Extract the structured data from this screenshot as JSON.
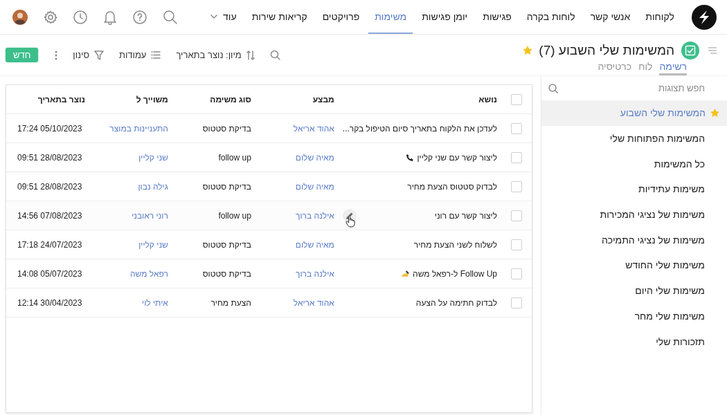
{
  "nav": {
    "items": [
      {
        "label": "לקוחות",
        "selected": false
      },
      {
        "label": "אנשי קשר",
        "selected": false
      },
      {
        "label": "לוחות בקרה",
        "selected": false
      },
      {
        "label": "פגישות",
        "selected": false
      },
      {
        "label": "יומן פגישות",
        "selected": false
      },
      {
        "label": "משימות",
        "selected": true
      },
      {
        "label": "פרויקטים",
        "selected": false
      },
      {
        "label": "קריאות שירות",
        "selected": false
      }
    ],
    "more": "עוד"
  },
  "view": {
    "title": "המשימות שלי השבוע (7)",
    "starred": true,
    "tabs": [
      {
        "label": "רשימה",
        "selected": true
      },
      {
        "label": "לוח",
        "selected": false
      },
      {
        "label": "כרטיסיה",
        "selected": false
      }
    ]
  },
  "toolbar": {
    "sort": "מיון: נוצר בתאריך",
    "columns": "עמודות",
    "filter": "סינון",
    "new_button": "חדש"
  },
  "sidebar": {
    "search": {
      "placeholder": "חפש תצוגות"
    },
    "items": [
      {
        "label": "המשימות שלי השבוע",
        "selected": true,
        "starred": true
      },
      {
        "label": "המשימות הפתוחות שלי",
        "selected": false,
        "starred": false
      },
      {
        "label": "כל המשימות",
        "selected": false,
        "starred": false
      },
      {
        "label": "משימות עתידיות",
        "selected": false,
        "starred": false
      },
      {
        "label": "משימות של נציגי המכירות",
        "selected": false,
        "starred": false
      },
      {
        "label": "משימות של נציגי התמיכה",
        "selected": false,
        "starred": false
      },
      {
        "label": "משימות שלי החודש",
        "selected": false,
        "starred": false
      },
      {
        "label": "משימות שלי היום",
        "selected": false,
        "starred": false
      },
      {
        "label": "משימות שלי מחר",
        "selected": false,
        "starred": false
      },
      {
        "label": "תזכורות שלי",
        "selected": false,
        "starred": false
      }
    ]
  },
  "table": {
    "all_checked": false,
    "columns": [
      "נושא",
      "מבצע",
      "סוג משימה",
      "משוייך ל",
      "נוצר בתאריך"
    ],
    "rows": [
      {
        "checked": false,
        "subject": "לעדכן את הלקוח בתאריך סיום הטיפול בקר...",
        "performer": "אהוד אריאל",
        "type": "בדיקת סטטוס",
        "assigned": "התעניינות במוצר",
        "created": "17:24 05/10/2023",
        "hovered": false
      },
      {
        "checked": false,
        "subject": "ליצור קשר עם שני קליין",
        "kind": "phone",
        "performer": "מאיה שלום",
        "type": "follow up",
        "assigned": "שני קליין",
        "created": "09:51 28/08/2023",
        "hovered": false
      },
      {
        "checked": false,
        "subject": "לבדוק סטטוס הצעת מחיר",
        "performer": "מאיה שלום",
        "type": "בדיקת סטטוס",
        "assigned": "גילה נבון",
        "created": "09:51 28/08/2023",
        "hovered": false
      },
      {
        "checked": false,
        "subject": "ליצור קשר עם רוני",
        "performer": "אילנה ברוך",
        "type": "follow up",
        "assigned": "רוני ראובני",
        "created": "14:56 07/08/2023",
        "hovered": true
      },
      {
        "checked": false,
        "subject": "לשלוח לשני הצעת מחיר",
        "performer": "מאיה שלום",
        "type": "בדיקת סטטוס",
        "assigned": "שני קליין",
        "created": "17:18 24/07/2023",
        "hovered": false
      },
      {
        "checked": false,
        "subject": "Follow Up ל-רפאל משה",
        "kind": "writing",
        "performer": "אילנה ברוך",
        "type": "בדיקת סטטוס",
        "assigned": "רפאל משה",
        "created": "14:08 05/07/2023",
        "hovered": false
      },
      {
        "checked": false,
        "subject": "לבדוק חתימה על הצעה",
        "performer": "אהוד אריאל",
        "type": "הצעת מחיר",
        "assigned": "איתי לוי",
        "created": "12:14 30/04/2023",
        "hovered": false
      }
    ]
  }
}
